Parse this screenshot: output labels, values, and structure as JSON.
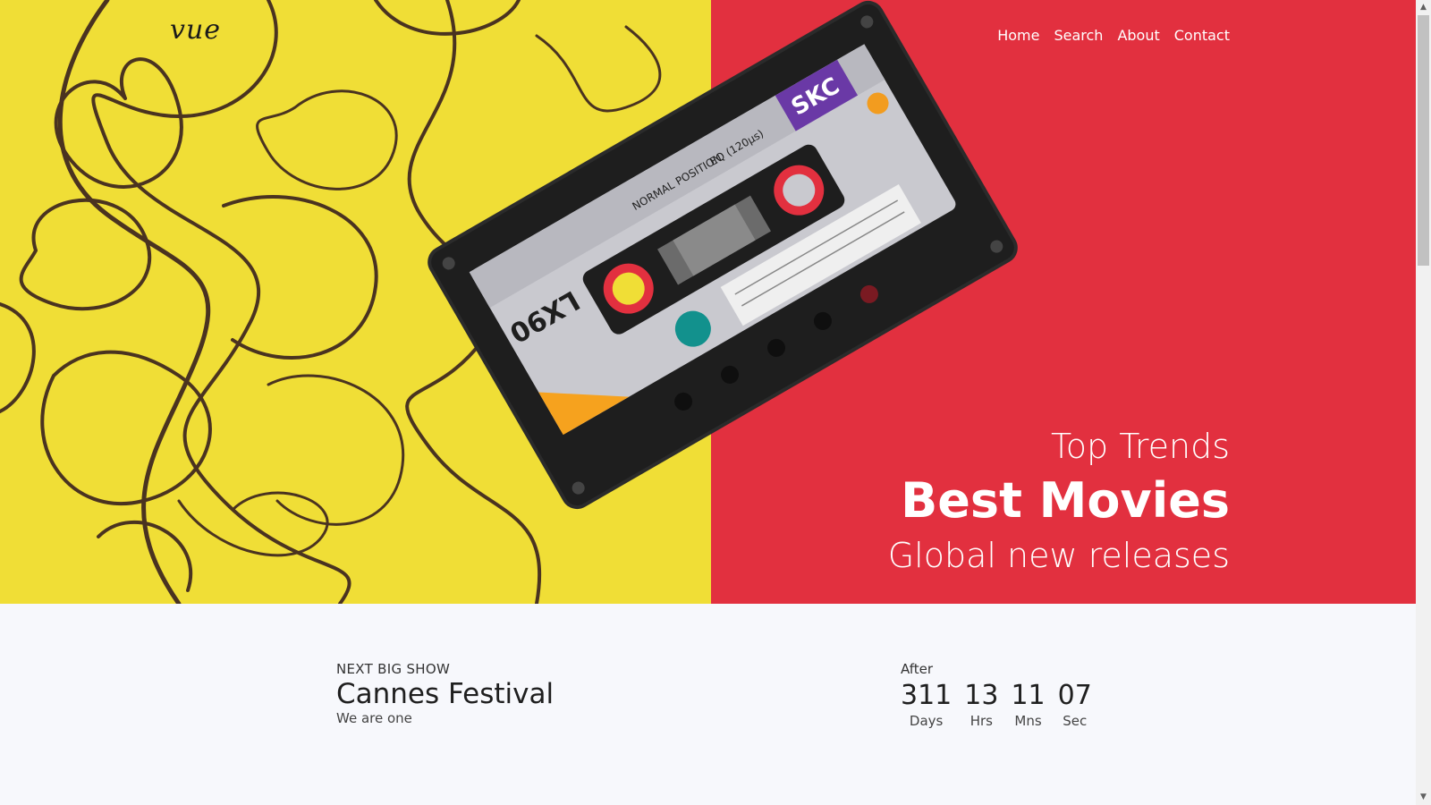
{
  "logo": "vue",
  "nav": {
    "home": "Home",
    "search": "Search",
    "about": "About",
    "contact": "Contact"
  },
  "hero": {
    "line1": "Top Trends",
    "line2": "Best Movies",
    "line3": "Global new releases",
    "cassette_brand": "SKC",
    "cassette_model": "LX90",
    "cassette_text1": "NORMAL POSITION",
    "cassette_text2": "EQ (120µs)",
    "colors": {
      "left": "#f0de36",
      "right": "#e2303f",
      "cassette": "#1e1e1e"
    }
  },
  "show": {
    "eyebrow": "NEXT BIG SHOW",
    "title": "Cannes Festival",
    "subtitle": "We are one"
  },
  "countdown": {
    "after": "After",
    "units": [
      {
        "value": "311",
        "label": "Days"
      },
      {
        "value": "13",
        "label": "Hrs"
      },
      {
        "value": "11",
        "label": "Mns"
      },
      {
        "value": "07",
        "label": "Sec"
      }
    ]
  }
}
